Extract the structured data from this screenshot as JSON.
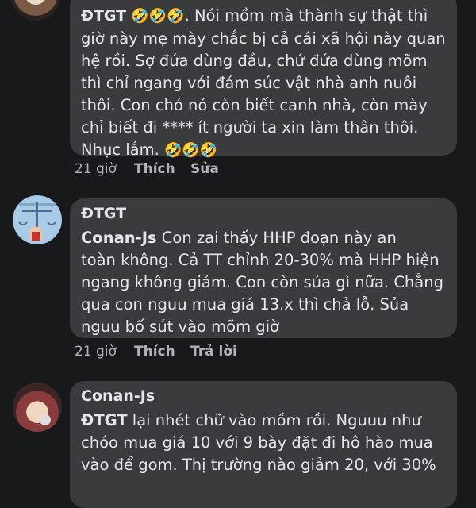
{
  "comments": [
    {
      "author": "ĐTGT",
      "emoji_lead": "🤣🤣🤣",
      "lines": [
        ". Nói mồm mà thành sự thật thì",
        "giờ này mẹ mày chắc bị cả cái xã hội này quan",
        "hệ rồi. Sợ đứa dùng đầu, chứ đứa dùng mõm",
        "thì chỉ ngang với đám súc vật nhà anh nuôi",
        "thôi. Con chó nó còn biết canh nhà, còn mày",
        "chỉ biết đi **** ít người ta xin làm thân thôi."
      ],
      "last_line": "Nhục lắm. ",
      "emoji_trail": "🤣🤣🤣",
      "time": "21 giờ",
      "like": "Thích",
      "third_action": "Sửa"
    },
    {
      "author": "ĐTGT",
      "mention": "Conan-Js",
      "first_line": "  Con zai thấy HHP đoạn này an",
      "lines": [
        "toàn không. Cả TT chỉnh 20-30% mà HHP hiện",
        "ngang không giảm. Con còn sủa gì nữa. Chẳng",
        "qua con nguu mua giá 13.x thì chả lỗ. Sủa",
        "nguu bố sút vào mõm giờ"
      ],
      "time": "21 giờ",
      "like": "Thích",
      "third_action": "Trả lời"
    },
    {
      "author": "Conan-Js",
      "mention": "ĐTGT",
      "first_line": "  lại nhét chữ vào mồm rồi. Nguuu như",
      "lines": [
        "chóo mua giá 10 với 9 bày đặt đi hô hào mua",
        "vào để gom. Thị trường nào giảm 20, với 30%"
      ]
    }
  ]
}
